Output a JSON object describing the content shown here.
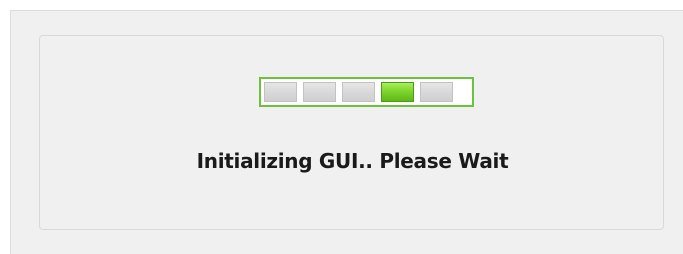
{
  "dialog": {
    "status_text": "Initializing GUI.. Please Wait"
  },
  "progress": {
    "segment_count": 5,
    "active_segment_index": 3,
    "active_color": "#7ad22a",
    "border_color": "#6cc23a",
    "inactive_color": "#d9d9d9"
  }
}
